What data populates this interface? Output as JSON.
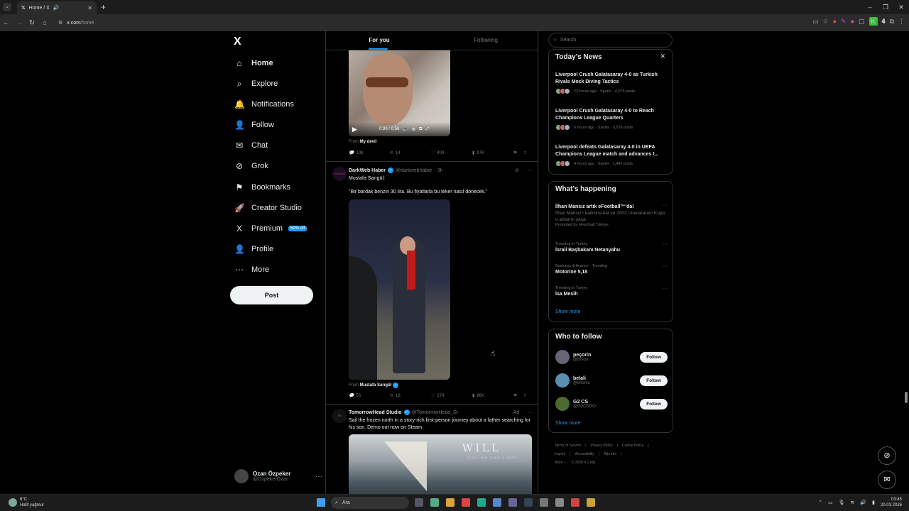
{
  "browser": {
    "tab_title": "Home / X",
    "url_host": "x.com",
    "url_path": "/home",
    "ext_count": "4"
  },
  "nav": {
    "logo": "X",
    "items": [
      {
        "label": "Home",
        "icon": "home-icon",
        "glyph": "⌂"
      },
      {
        "label": "Explore",
        "icon": "search-icon",
        "glyph": "⌕"
      },
      {
        "label": "Notifications",
        "icon": "bell-icon",
        "glyph": "🔔"
      },
      {
        "label": "Follow",
        "icon": "person-add-icon",
        "glyph": "👤"
      },
      {
        "label": "Chat",
        "icon": "mail-icon",
        "glyph": "✉"
      },
      {
        "label": "Grok",
        "icon": "grok-icon",
        "glyph": "⊘"
      },
      {
        "label": "Bookmarks",
        "icon": "bookmark-icon",
        "glyph": "⚑"
      },
      {
        "label": "Creator Studio",
        "icon": "rocket-icon",
        "glyph": "🚀"
      },
      {
        "label": "Premium",
        "icon": "x-premium-icon",
        "glyph": "X"
      },
      {
        "label": "Profile",
        "icon": "profile-icon",
        "glyph": "👤"
      },
      {
        "label": "More",
        "icon": "more-circle-icon",
        "glyph": "⋯"
      }
    ],
    "premium_badge": "50% off",
    "post_button": "Post",
    "account": {
      "name": "Ozan Özpeker",
      "handle": "@OzpekerOzan"
    }
  },
  "feed": {
    "tabs": [
      "For you",
      "Following"
    ],
    "post1": {
      "video_time": "0:00 / 0:56",
      "from_label": "From",
      "from_name": "My devil",
      "replies": "108",
      "reposts": "14",
      "likes": "404",
      "views": "97K"
    },
    "post2": {
      "name": "DarkWeb Haber",
      "handle": "@darkwebhaber",
      "time": "· 3h",
      "line1": "Mustafa Sarıgül:",
      "line2": "\"Bir bardak benzin 30 lira. Bu fiyatlarla bu teker nasıl dönecek.\"",
      "from_label": "From",
      "from_name": "Mustafa Sarıgül",
      "replies": "55",
      "reposts": "18",
      "likes": "274",
      "views": "86K"
    },
    "post3": {
      "name": "TomorrowHead Studio",
      "handle": "@TomorrowHead_St",
      "ad_label": "Ad",
      "text": "Sail the frozen north in a story-rich first-person journey about a father searching for his son. Demo out now on Steam.",
      "media_title": "WILL",
      "media_sub": "FOLLOW THE LIGHT"
    }
  },
  "right": {
    "search_placeholder": "Search",
    "news": {
      "title": "Today's News",
      "items": [
        {
          "title": "Liverpool Crush Galatasaray 4-0 as Turkish Rivals Mock Diving Tactics",
          "meta": "23 hours ago · Sports · 4,075 posts"
        },
        {
          "title": "Liverpool Crush Galatasaray 4-0 to Reach Champions League Quarters",
          "meta": "6 hours ago · Sports · 3,226 posts"
        },
        {
          "title": "Liverpool defeats Galatasaray 4-0 in UEFA Champions League match and advances t...",
          "meta": "4 hours ago · Sports · 1,442 posts"
        }
      ]
    },
    "happening": {
      "title": "What's happening",
      "items": [
        {
          "category": "",
          "title": "İlhan Mansız artık eFootball™'da!",
          "desc": "İlhan Mansız'ı kadrona kat ve 2002 Uluslararası Kupa o anlarını yaşa.",
          "promo": "Promoted by eFootball Türkiye"
        },
        {
          "category": "Trending in Turkey",
          "title": "İsrail Başbakanı Netanyahu",
          "desc": "",
          "promo": ""
        },
        {
          "category": "Business & finance · Trending",
          "title": "Motorine 5,18",
          "desc": "",
          "promo": ""
        },
        {
          "category": "Trending in Turkey",
          "title": "İsa Mesih",
          "desc": "",
          "promo": ""
        }
      ],
      "show_more": "Show more"
    },
    "who": {
      "title": "Who to follow",
      "items": [
        {
          "name": "peçorin",
          "handle": "@brsoo",
          "button": "Follow"
        },
        {
          "name": "belali",
          "handle": "@imorcs",
          "button": "Follow"
        },
        {
          "name": "G2 CS",
          "handle": "@G2CSGO",
          "button": "Follow"
        }
      ],
      "show_more": "Show more"
    },
    "footer": [
      "Terms of Service",
      "|",
      "Privacy Policy",
      "|",
      "Cookie Policy",
      "|",
      "Imprint",
      "|",
      "Accessibility",
      "|",
      "Ads info",
      "|",
      "More ···",
      "© 2026 X Corp."
    ]
  },
  "taskbar": {
    "temp": "6°C",
    "weather": "Hafif yağmur",
    "search": "Ara",
    "time": "03:45",
    "date": "20.03.2026"
  }
}
